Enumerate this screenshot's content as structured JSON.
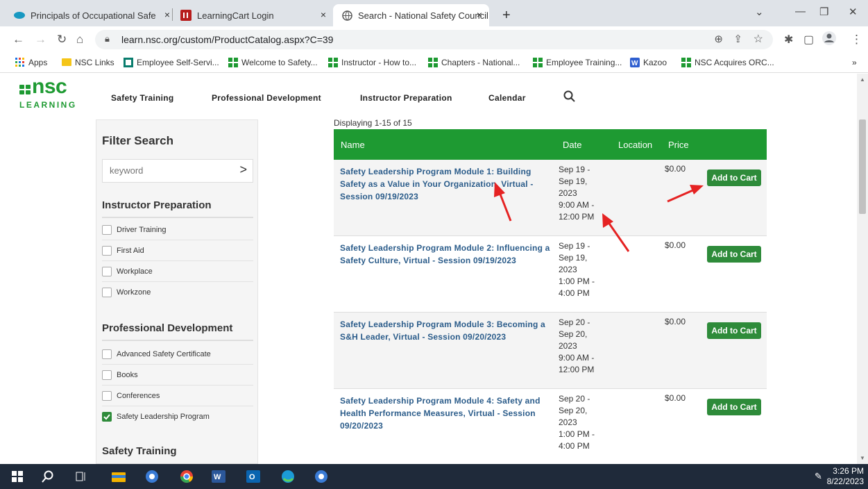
{
  "browser": {
    "tabs": [
      {
        "title": "Principals of Occupational Safety",
        "close": "×"
      },
      {
        "title": "LearningCart Login",
        "close": "×"
      },
      {
        "title": "Search - National Safety Council",
        "close": "×"
      }
    ],
    "new_tab": "+",
    "url": "learn.nsc.org/custom/ProductCatalog.aspx?C=39",
    "bookmarks": [
      {
        "label": "Apps",
        "icon": "apps-grid-icon"
      },
      {
        "label": "NSC Links",
        "icon": "folder-icon"
      },
      {
        "label": "Employee Self-Servi...",
        "icon": "employee-self-service-icon"
      },
      {
        "label": "Welcome to Safety...",
        "icon": "nsc-icon"
      },
      {
        "label": "Instructor - How to...",
        "icon": "nsc-icon"
      },
      {
        "label": "Chapters - National...",
        "icon": "nsc-icon"
      },
      {
        "label": "Employee Training...",
        "icon": "nsc-icon"
      },
      {
        "label": "Kazoo",
        "icon": "kazoo-icon"
      },
      {
        "label": "NSC Acquires ORC...",
        "icon": "nsc-icon"
      }
    ],
    "bookmarks_more": "»"
  },
  "site": {
    "logo_top": "nsc",
    "logo_bottom": "LEARNING",
    "nav": [
      "Safety Training",
      "Professional Development",
      "Instructor Preparation",
      "Calendar"
    ]
  },
  "sidebar": {
    "title": "Filter Search",
    "keyword_placeholder": "keyword",
    "keyword_go": ">",
    "sections": [
      {
        "title": "Instructor Preparation",
        "items": [
          {
            "label": "Driver Training",
            "checked": false
          },
          {
            "label": "First Aid",
            "checked": false
          },
          {
            "label": "Workplace",
            "checked": false
          },
          {
            "label": "Workzone",
            "checked": false
          }
        ]
      },
      {
        "title": "Professional Development",
        "items": [
          {
            "label": "Advanced Safety Certificate",
            "checked": false
          },
          {
            "label": "Books",
            "checked": false
          },
          {
            "label": "Conferences",
            "checked": false
          },
          {
            "label": "Safety Leadership Program",
            "checked": true
          }
        ]
      },
      {
        "title": "Safety Training",
        "items": []
      }
    ]
  },
  "results": {
    "display": "Displaying 1-15 of 15",
    "columns": [
      "Name",
      "Date",
      "Location",
      "Price"
    ],
    "rows": [
      {
        "name": "Safety Leadership Program Module 1: Building Safety as a Value in Your Organization, Virtual - Session 09/19/2023",
        "date": [
          "Sep 19 -",
          "Sep 19,",
          "2023",
          "9:00 AM -",
          "12:00 PM"
        ],
        "location": "",
        "price": "$0.00",
        "button": "Add to Cart"
      },
      {
        "name": "Safety Leadership Program Module 2: Influencing a Safety Culture, Virtual - Session 09/19/2023",
        "date": [
          "Sep 19 -",
          "Sep 19,",
          "2023",
          "1:00 PM -",
          "4:00 PM"
        ],
        "location": "",
        "price": "$0.00",
        "button": "Add to Cart"
      },
      {
        "name": "Safety Leadership Program Module 3: Becoming a S&H Leader, Virtual - Session 09/20/2023",
        "date": [
          "Sep 20 -",
          "Sep 20,",
          "2023",
          "9:00 AM -",
          "12:00 PM"
        ],
        "location": "",
        "price": "$0.00",
        "button": "Add to Cart"
      },
      {
        "name": "Safety Leadership Program Module 4: Safety and Health Performance Measures, Virtual - Session 09/20/2023",
        "date": [
          "Sep 20 -",
          "Sep 20,",
          "2023",
          "1:00 PM -",
          "4:00 PM"
        ],
        "location": "",
        "price": "$0.00",
        "button": "Add to Cart"
      }
    ]
  },
  "taskbar": {
    "time": "3:26 PM",
    "date": "8/22/2023",
    "icons": [
      "windows-start-icon",
      "search-icon",
      "task-view-icon",
      "file-explorer-icon",
      "app-icon",
      "chrome-icon",
      "word-icon",
      "outlook-icon",
      "edge-icon",
      "app-icon"
    ]
  },
  "colors": {
    "header_green": "#1e9a32",
    "button_green": "#2e8b3a",
    "link_blue": "#2b5c8a",
    "annotation_red": "#e52222"
  }
}
